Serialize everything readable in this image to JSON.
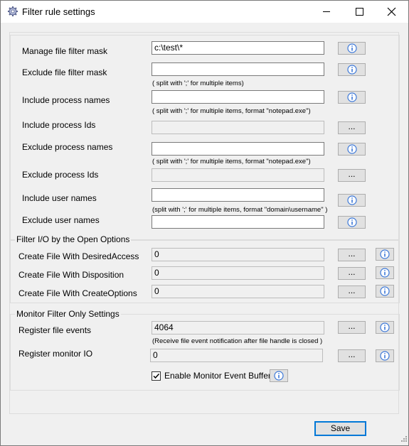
{
  "window": {
    "title": "Filter rule settings"
  },
  "icons": {
    "app": "gear-icon",
    "info": "info-icon",
    "minimize": "minimize-icon",
    "maximize": "maximize-icon",
    "close": "close-icon"
  },
  "colors": {
    "accent": "#0078d7",
    "info_icon": "#3c78d8"
  },
  "main": {
    "manage_mask": {
      "label": "Manage file filter mask",
      "value": "c:\\test\\*"
    },
    "exclude_mask": {
      "label": "Exclude file filter mask",
      "value": "",
      "hint": "( split with ';' for multiple items)"
    },
    "include_proc_names": {
      "label": "Include process names",
      "value": "",
      "hint": "( split with ';' for multiple items, format \"notepad.exe\")"
    },
    "include_proc_ids": {
      "label": "Include process Ids",
      "value": "",
      "button": "..."
    },
    "exclude_proc_names": {
      "label": "Exclude process names",
      "value": "",
      "hint": "( split with ';' for multiple items, format \"notepad.exe\")"
    },
    "exclude_proc_ids": {
      "label": "Exclude process Ids",
      "value": "",
      "button": "..."
    },
    "include_users": {
      "label": "Include user names",
      "value": "",
      "hint": "(split with ';' for multiple items, format \"domain\\username\" )"
    },
    "exclude_users": {
      "label": "Exclude user names",
      "value": ""
    }
  },
  "open_options": {
    "title": "Filter I/O by the Open Options",
    "desired_access": {
      "label": "Create File With DesiredAccess",
      "value": "0",
      "button": "..."
    },
    "disposition": {
      "label": "Create File With Disposition",
      "value": "0",
      "button": "..."
    },
    "create_options": {
      "label": "Create File With CreateOptions",
      "value": "0",
      "button": "..."
    }
  },
  "monitor": {
    "title": "Monitor Filter Only Settings",
    "file_events": {
      "label": "Register file events",
      "value": "4064",
      "button": "...",
      "hint": "(Receive file event notification after file handle is closed )"
    },
    "monitor_io": {
      "label": "Register monitor IO",
      "value": "0",
      "button": "..."
    },
    "event_buffer": {
      "label": "Enable Monitor Event Buffer",
      "checked": true
    }
  },
  "footer": {
    "save_label": "Save"
  }
}
